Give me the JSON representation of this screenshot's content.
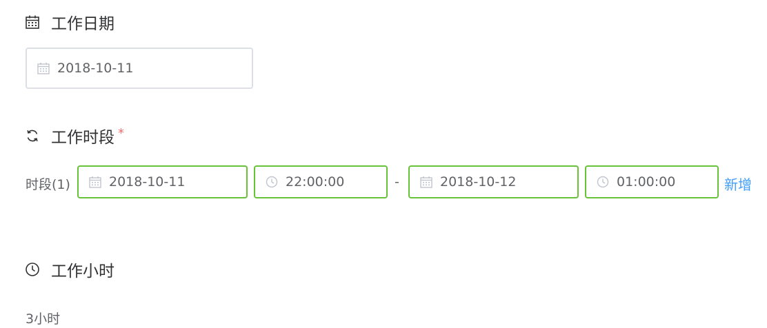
{
  "work_date": {
    "title": "工作日期",
    "title_icon": "calendar-icon",
    "value": "2018-10-11",
    "prefix_icon": "calendar-icon"
  },
  "work_period": {
    "title": "工作时段",
    "title_icon": "refresh-icon",
    "required_mark": "*",
    "rows": [
      {
        "label": "时段(1)",
        "start_date": "2018-10-11",
        "start_time": "22:00:00",
        "separator": "-",
        "end_date": "2018-10-12",
        "end_time": "01:00:00",
        "add_label": "新增"
      }
    ]
  },
  "work_hours": {
    "title": "工作小时",
    "title_icon": "clock-icon",
    "value": "3小时"
  },
  "colors": {
    "valid_border": "#67c23a",
    "default_border": "#dcdfe6",
    "link": "#409eff",
    "required": "#f56c6c"
  }
}
